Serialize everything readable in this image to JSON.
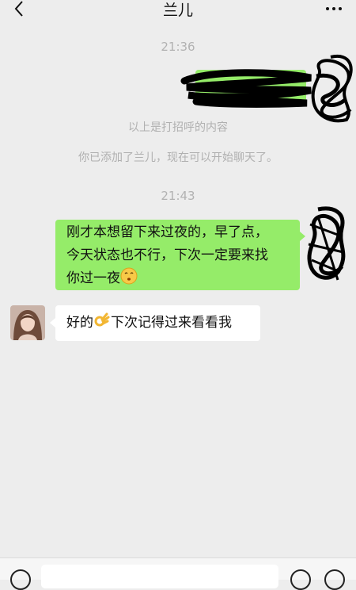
{
  "header": {
    "title": "兰儿"
  },
  "chat": {
    "time_first": "21:36",
    "sys_greeting": "以上是打招呼的内容",
    "sys_added": "你已添加了兰儿，现在可以开始聊天了。",
    "time_second": "21:43",
    "msg_sent": {
      "line1": "刚才本想留下来过夜的，早了点，",
      "line2": "今天状态也不行，下次一定要来找",
      "line3": "你过一夜"
    },
    "msg_received": {
      "part1": "好的",
      "part2": "下次记得过来看看我"
    }
  },
  "icons": [
    "back-chevron-icon",
    "more-dots-icon",
    "kiss-emoji-icon",
    "ok-hand-emoji-icon",
    "voice-icon",
    "emoji-icon",
    "plus-icon"
  ],
  "colors": {
    "sent_bubble": "#95ec69",
    "received_bubble": "#ffffff",
    "background": "#ededed"
  }
}
